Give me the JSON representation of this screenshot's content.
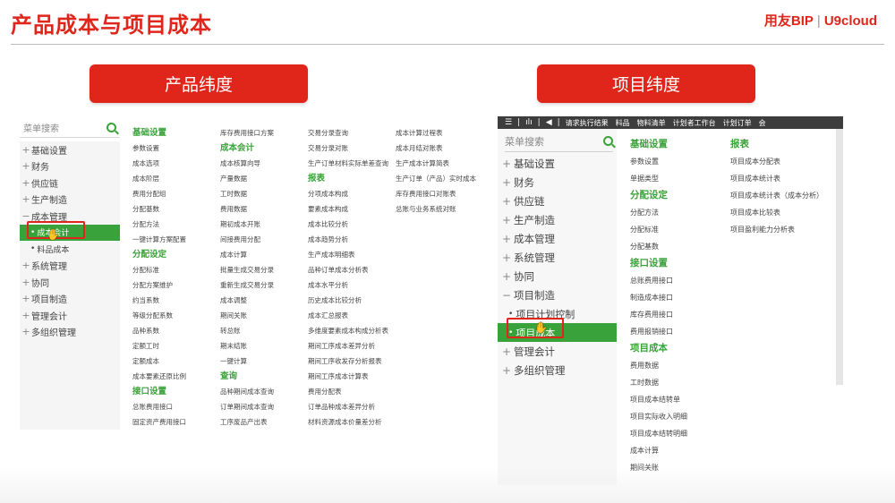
{
  "slide_title": "产品成本与项目成本",
  "brand": {
    "name": "用友BIP",
    "sub": "U9cloud"
  },
  "left_section": "产品纬度",
  "right_section": "项目纬度",
  "left_panel": {
    "search_placeholder": "菜单搜索",
    "tree": [
      {
        "sym": "+",
        "label": "基础设置"
      },
      {
        "sym": "+",
        "label": "财务"
      },
      {
        "sym": "+",
        "label": "供应链"
      },
      {
        "sym": "+",
        "label": "生产制造"
      },
      {
        "sym": "−",
        "label": "成本管理"
      },
      {
        "sym": "•",
        "label": "成本会计"
      },
      {
        "sym": "•",
        "label": "料品成本"
      },
      {
        "sym": "+",
        "label": "系统管理"
      },
      {
        "sym": "+",
        "label": "协同"
      },
      {
        "sym": "+",
        "label": "项目制造"
      },
      {
        "sym": "+",
        "label": "管理会计"
      },
      {
        "sym": "+",
        "label": "多组织管理"
      }
    ],
    "col1": [
      "基础设置",
      "参数设置",
      "成本选项",
      "成本阶层",
      "费用分配组",
      "分配基数",
      "分配方法",
      "一键计算方案配置",
      "分配设定",
      "分配标准",
      "分配方案维护",
      "约当系数",
      "等级分配系数",
      "品种系数",
      "定额工时",
      "定额成本",
      "成本要素还原比例",
      "接口设置",
      "总账费用接口",
      "固定资产费用接口"
    ],
    "col2": [
      "库存费用接口方案",
      "成本会计",
      "成本核算向导",
      "产量数据",
      "工时数据",
      "费用数据",
      "期初成本开账",
      "间接费用分配",
      "成本计算",
      "批量生成交易分录",
      "重新生成交易分录",
      "成本调整",
      "期间关账",
      "转总账",
      "期末结账",
      "一键计算",
      "查询",
      "品种期间成本查询",
      "订单期间成本查询",
      "工序废品产出表"
    ],
    "col3": [
      "交易分录查询",
      "交易分录对账",
      "生产订单材料实际单差查询",
      "报表",
      "分项成本构成",
      "要素成本构成",
      "成本比较分析",
      "成本趋势分析",
      "生产成本明细表",
      "品种订单成本分析表",
      "成本水平分析",
      "历史成本比较分析",
      "成本汇总报表",
      "多维度要素成本构成分析表",
      "期间工序成本差异分析",
      "期间工序收发存分析报表",
      "期间工序成本计算表",
      "费用分配表",
      "订单品种成本差异分析",
      "材料资源成本价量差分析"
    ],
    "col4": [
      "成本计算过程表",
      "成本月结对账表",
      "生产成本计算简表",
      "生产订单（产品）实时成本",
      "库存费用接口对账表",
      "总账与业务系统对账"
    ]
  },
  "right_panel": {
    "topbar": {
      "icons": [
        "☰",
        "|",
        "ılı",
        "|",
        "◀",
        "|"
      ],
      "items": [
        "请求执行结果",
        "料品",
        "物料清单",
        "计划者工作台",
        "计划订单",
        "会"
      ]
    },
    "search_placeholder": "菜单搜索",
    "tree": [
      {
        "sym": "+",
        "label": "基础设置"
      },
      {
        "sym": "+",
        "label": "财务"
      },
      {
        "sym": "+",
        "label": "供应链"
      },
      {
        "sym": "+",
        "label": "生产制造"
      },
      {
        "sym": "+",
        "label": "成本管理"
      },
      {
        "sym": "+",
        "label": "系统管理"
      },
      {
        "sym": "+",
        "label": "协同"
      },
      {
        "sym": "−",
        "label": "项目制造"
      },
      {
        "sym": "•",
        "label": "项目计划控制"
      },
      {
        "sym": "•",
        "label": "项目成本"
      },
      {
        "sym": "+",
        "label": "管理会计"
      },
      {
        "sym": "+",
        "label": "多组织管理"
      }
    ],
    "col1": [
      "基础设置",
      "参数设置",
      "单据类型",
      "分配设定",
      "分配方法",
      "分配标准",
      "分配基数",
      "接口设置",
      "总账费用接口",
      "制造成本接口",
      "库存费用接口",
      "费用报销接口",
      "项目成本",
      "费用数据",
      "工时数据",
      "项目成本结转单",
      "项目实际收入明细",
      "项目成本结转明细",
      "成本计算",
      "期间关账"
    ],
    "col2": [
      "报表",
      "项目成本分配表",
      "项目成本统计表",
      "项目成本统计表（成本分析）",
      "项目成本比较表",
      "项目盈利能力分析表"
    ]
  }
}
